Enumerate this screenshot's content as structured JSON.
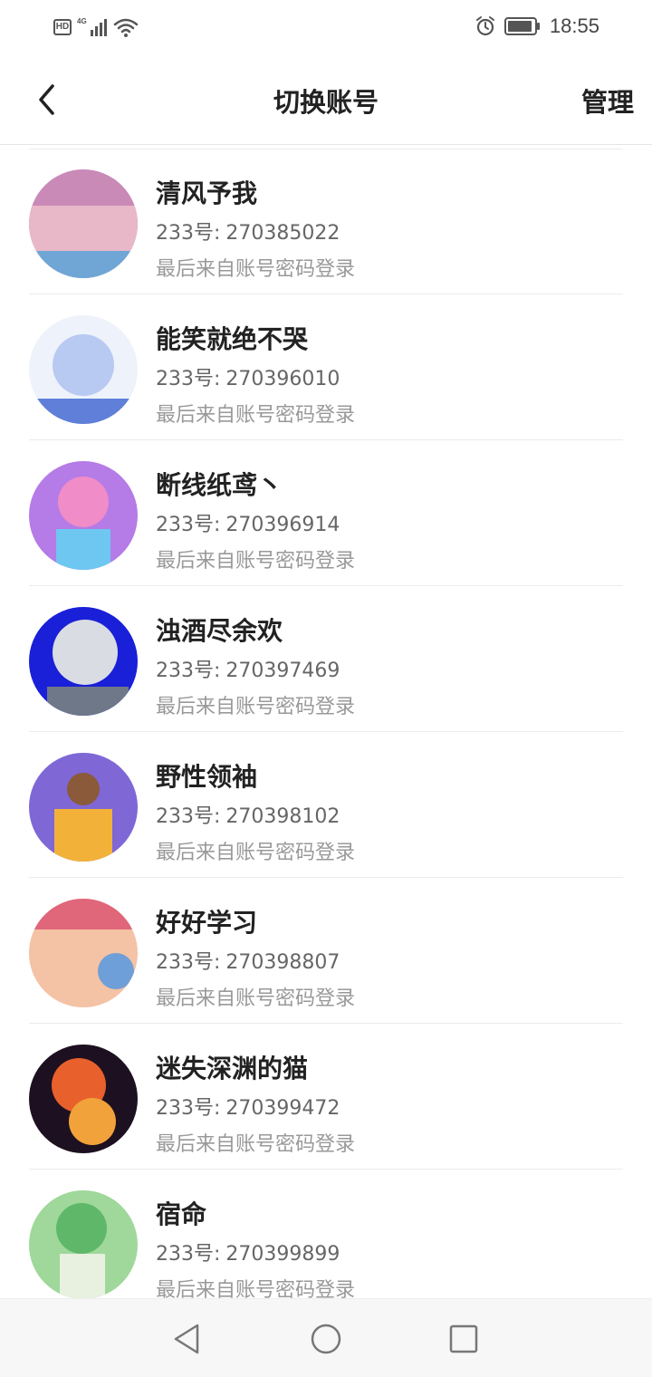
{
  "status_bar": {
    "hd_badge": "HD",
    "network": "4G",
    "time": "18:55",
    "icons": [
      "signal-icon",
      "wifi-icon",
      "alarm-icon",
      "battery-icon"
    ]
  },
  "header": {
    "title": "切换账号",
    "manage_label": "管理",
    "back_icon": "chevron-left-icon"
  },
  "accounts": [
    {
      "name": "清风予我",
      "uid_label": "233号:",
      "uid": "270385022",
      "source": "最后来自账号密码登录",
      "avatar_colors": [
        "#c98ab8",
        "#e8b7c8",
        "#6fa6d6"
      ]
    },
    {
      "name": "能笑就绝不哭",
      "uid_label": "233号:",
      "uid": "270396010",
      "source": "最后来自账号密码登录",
      "avatar_colors": [
        "#eef2fb",
        "#b8c9f2",
        "#5f7fd8"
      ]
    },
    {
      "name": "断线纸鸢丶",
      "uid_label": "233号:",
      "uid": "270396914",
      "source": "最后来自账号密码登录",
      "avatar_colors": [
        "#b57be6",
        "#f08cc8",
        "#6dc7f0"
      ]
    },
    {
      "name": "浊酒尽余欢",
      "uid_label": "233号:",
      "uid": "270397469",
      "source": "最后来自账号密码登录",
      "avatar_colors": [
        "#1a1fd8",
        "#d9dde3",
        "#6f7888"
      ]
    },
    {
      "name": "野性领袖",
      "uid_label": "233号:",
      "uid": "270398102",
      "source": "最后来自账号密码登录",
      "avatar_colors": [
        "#7f67d6",
        "#f2b23a",
        "#8a5a3a"
      ]
    },
    {
      "name": "好好学习",
      "uid_label": "233号:",
      "uid": "270398807",
      "source": "最后来自账号密码登录",
      "avatar_colors": [
        "#e0667a",
        "#f4c2a4",
        "#6f9fd8"
      ]
    },
    {
      "name": "迷失深渊的猫",
      "uid_label": "233号:",
      "uid": "270399472",
      "source": "最后来自账号密码登录",
      "avatar_colors": [
        "#1d1020",
        "#e8602c",
        "#f2a23a"
      ]
    },
    {
      "name": "宿命",
      "uid_label": "233号:",
      "uid": "270399899",
      "source": "最后来自账号密码登录",
      "avatar_colors": [
        "#9fd89a",
        "#5fb86a",
        "#e8f0e0"
      ]
    }
  ],
  "nav_bar": {
    "buttons": [
      "back-triangle-icon",
      "home-circle-icon",
      "recents-square-icon"
    ]
  }
}
